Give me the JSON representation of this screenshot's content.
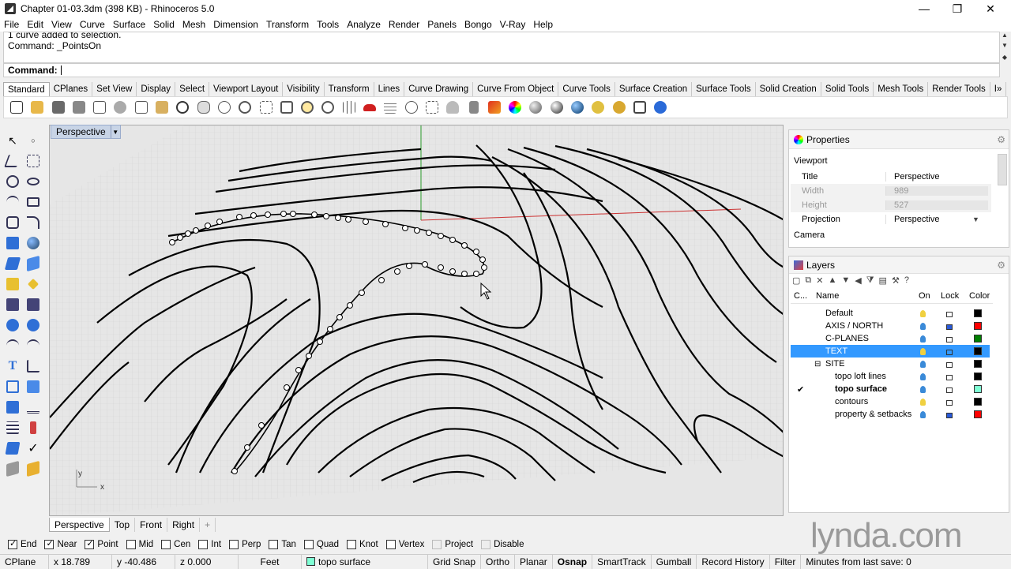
{
  "window": {
    "title": "Chapter 01-03.3dm (398 KB) - Rhinoceros 5.0",
    "minimize": "—",
    "maximize": "❐",
    "close": "✕"
  },
  "menu": [
    "File",
    "Edit",
    "View",
    "Curve",
    "Surface",
    "Solid",
    "Mesh",
    "Dimension",
    "Transform",
    "Tools",
    "Analyze",
    "Render",
    "Panels",
    "Bongo",
    "V-Ray",
    "Help"
  ],
  "command_history": {
    "line1": "1 curve added to selection.",
    "line2": "Command: _PointsOn"
  },
  "command_prompt": "Command:",
  "toolbar_tabs": [
    "Standard",
    "CPlanes",
    "Set View",
    "Display",
    "Select",
    "Viewport Layout",
    "Visibility",
    "Transform",
    "Lines",
    "Curve Drawing",
    "Curve From Object",
    "Curve Tools",
    "Surface Creation",
    "Surface Tools",
    "Solid Creation",
    "Solid Tools",
    "Mesh Tools",
    "Render Tools",
    "I»"
  ],
  "viewport": {
    "title": "Perspective",
    "axis_x": "x",
    "axis_y": "y"
  },
  "view_tabs": [
    "Perspective",
    "Top",
    "Front",
    "Right",
    "+"
  ],
  "properties": {
    "panel_title": "Properties",
    "section_viewport": "Viewport",
    "rows": [
      {
        "label": "Title",
        "value": "Perspective"
      },
      {
        "label": "Width",
        "value": "989"
      },
      {
        "label": "Height",
        "value": "527"
      },
      {
        "label": "Projection",
        "value": "Perspective"
      }
    ],
    "section_camera": "Camera"
  },
  "layers": {
    "panel_title": "Layers",
    "headers": {
      "current": "C...",
      "name": "Name",
      "on": "On",
      "lock": "Lock",
      "color": "Color"
    },
    "rows": [
      {
        "name": "Default",
        "color": "#000000",
        "locked": false,
        "bold": false,
        "current": false
      },
      {
        "name": "AXIS / NORTH",
        "color": "#ff0000",
        "locked": true,
        "bold": false,
        "current": false
      },
      {
        "name": "C-PLANES",
        "color": "#008000",
        "locked": false,
        "bold": false,
        "current": false
      },
      {
        "name": "TEXT",
        "color": "#000000",
        "locked": false,
        "bold": false,
        "current": false,
        "selected": true
      },
      {
        "name": "SITE",
        "color": "#000000",
        "locked": false,
        "bold": false,
        "current": false,
        "collapse": "⊟"
      },
      {
        "name": "topo loft lines",
        "color": "#000000",
        "locked": false,
        "bold": false,
        "current": false
      },
      {
        "name": "topo surface",
        "color": "#7fffd4",
        "locked": false,
        "bold": true,
        "current": true,
        "check": "✔"
      },
      {
        "name": "contours",
        "color": "#000000",
        "locked": false,
        "bold": false,
        "current": false
      },
      {
        "name": "property & setbacks",
        "color": "#ff0000",
        "locked": true,
        "bold": false,
        "current": false
      }
    ]
  },
  "osnaps": [
    {
      "label": "End",
      "on": true
    },
    {
      "label": "Near",
      "on": true
    },
    {
      "label": "Point",
      "on": true
    },
    {
      "label": "Mid",
      "on": false
    },
    {
      "label": "Cen",
      "on": false
    },
    {
      "label": "Int",
      "on": false
    },
    {
      "label": "Perp",
      "on": false
    },
    {
      "label": "Tan",
      "on": false
    },
    {
      "label": "Quad",
      "on": false
    },
    {
      "label": "Knot",
      "on": false
    },
    {
      "label": "Vertex",
      "on": false
    },
    {
      "label": "Project",
      "on": false,
      "disabled": true
    },
    {
      "label": "Disable",
      "on": false,
      "disabled": true
    }
  ],
  "status": {
    "cplane": "CPlane",
    "x": "x 18.789",
    "y": "y -40.486",
    "z": "z 0.000",
    "units": "Feet",
    "layer": "topo surface",
    "layer_color": "#7fffd4",
    "grid_snap": "Grid Snap",
    "ortho": "Ortho",
    "planar": "Planar",
    "osnap": "Osnap",
    "smarttrack": "SmartTrack",
    "gumball": "Gumball",
    "record_history": "Record History",
    "filter": "Filter",
    "save_info": "Minutes from last save: 0"
  },
  "watermark": "lynda.com"
}
